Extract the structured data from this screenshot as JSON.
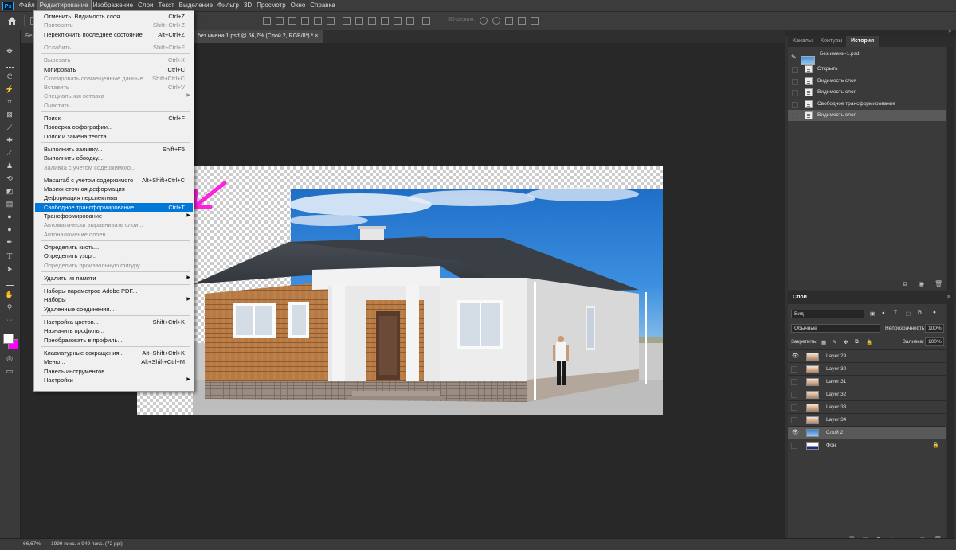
{
  "colors": {
    "accent": "#0078d7",
    "arrow": "#ff22dd",
    "fg_swatch": "#ffffff",
    "bg_swatch": "#ff00ff"
  },
  "menubar": {
    "items": [
      "Файл",
      "Редактирование",
      "Изображение",
      "Слои",
      "Текст",
      "Выделение",
      "Фильтр",
      "3D",
      "Просмотр",
      "Окно",
      "Справка"
    ],
    "active": "Редактирование"
  },
  "optbar": {
    "mode_3d": "3D-режим:"
  },
  "tabs": [
    {
      "label": "Без"
    },
    {
      "label": "без имени-1.psd @ 66,7% (Слой 2, RGB/8*) *",
      "close": "×"
    }
  ],
  "edit_menu": [
    {
      "label": "Отменить: Видимость слоя",
      "shortcut": "Ctrl+Z",
      "enabled": true
    },
    {
      "label": "Повторить",
      "shortcut": "Shift+Ctrl+Z",
      "enabled": false
    },
    {
      "label": "Переключить последнее состояние",
      "shortcut": "Alt+Ctrl+Z",
      "enabled": true
    },
    {
      "sep": true
    },
    {
      "label": "Ослабить...",
      "shortcut": "Shift+Ctrl+F",
      "enabled": false
    },
    {
      "sep": true
    },
    {
      "label": "Вырезать",
      "shortcut": "Ctrl+X",
      "enabled": false
    },
    {
      "label": "Копировать",
      "shortcut": "Ctrl+C",
      "enabled": true
    },
    {
      "label": "Скопировать совмещенные данные",
      "shortcut": "Shift+Ctrl+C",
      "enabled": false
    },
    {
      "label": "Вставить",
      "shortcut": "Ctrl+V",
      "enabled": false
    },
    {
      "label": "Специальная вставка",
      "shortcut": "",
      "enabled": false,
      "submenu": true
    },
    {
      "label": "Очистить",
      "shortcut": "",
      "enabled": false
    },
    {
      "sep": true
    },
    {
      "label": "Поиск",
      "shortcut": "Ctrl+F",
      "enabled": true
    },
    {
      "label": "Проверка орфографии...",
      "shortcut": "",
      "enabled": true
    },
    {
      "label": "Поиск и замена текста...",
      "shortcut": "",
      "enabled": true
    },
    {
      "sep": true
    },
    {
      "label": "Выполнить заливку...",
      "shortcut": "Shift+F5",
      "enabled": true
    },
    {
      "label": "Выполнить обводку...",
      "shortcut": "",
      "enabled": true
    },
    {
      "label": "Заливка с учетом содержимого...",
      "shortcut": "",
      "enabled": false
    },
    {
      "sep": true
    },
    {
      "label": "Масштаб с учетом содержимого",
      "shortcut": "Alt+Shift+Ctrl+C",
      "enabled": true
    },
    {
      "label": "Марионеточная деформация",
      "shortcut": "",
      "enabled": true
    },
    {
      "label": "Деформация перспективы",
      "shortcut": "",
      "enabled": true
    },
    {
      "label": "Свободное трансформирование",
      "shortcut": "Ctrl+T",
      "enabled": true,
      "highlighted": true
    },
    {
      "label": "Трансформирование",
      "shortcut": "",
      "enabled": true,
      "submenu": true
    },
    {
      "label": "Автоматически выравнивать слои...",
      "shortcut": "",
      "enabled": false
    },
    {
      "label": "Автоналожение слоев...",
      "shortcut": "",
      "enabled": false
    },
    {
      "sep": true
    },
    {
      "label": "Определить кисть...",
      "shortcut": "",
      "enabled": true
    },
    {
      "label": "Определить узор...",
      "shortcut": "",
      "enabled": true
    },
    {
      "label": "Определить произвольную фигуру...",
      "shortcut": "",
      "enabled": false
    },
    {
      "sep": true
    },
    {
      "label": "Удалить из памяти",
      "shortcut": "",
      "enabled": true,
      "submenu": true
    },
    {
      "sep": true
    },
    {
      "label": "Наборы параметров Adobe PDF...",
      "shortcut": "",
      "enabled": true
    },
    {
      "label": "Наборы",
      "shortcut": "",
      "enabled": true,
      "submenu": true
    },
    {
      "label": "Удаленные соединения...",
      "shortcut": "",
      "enabled": true
    },
    {
      "sep": true
    },
    {
      "label": "Настройка цветов...",
      "shortcut": "Shift+Ctrl+K",
      "enabled": true
    },
    {
      "label": "Назначить профиль...",
      "shortcut": "",
      "enabled": true
    },
    {
      "label": "Преобразовать в профиль...",
      "shortcut": "",
      "enabled": true
    },
    {
      "sep": true
    },
    {
      "label": "Клавиатурные сокращения...",
      "shortcut": "Alt+Shift+Ctrl+K",
      "enabled": true
    },
    {
      "label": "Меню...",
      "shortcut": "Alt+Shift+Ctrl+M",
      "enabled": true
    },
    {
      "label": "Панель инструментов...",
      "shortcut": "",
      "enabled": true
    },
    {
      "label": "Настройки",
      "shortcut": "",
      "enabled": true,
      "submenu": true
    }
  ],
  "submenu_arrow": "▶",
  "panels": {
    "collapse": "»",
    "tabs": [
      "Каналы",
      "Контуры",
      "История"
    ],
    "active_tab": "История",
    "history": {
      "snapshot": "Без имени-1.psd",
      "items": [
        "Открыть",
        "Видимость слоя",
        "Видимость слоя",
        "Свободное трансформирование",
        "Видимость слоя"
      ],
      "selected_index": 4
    },
    "layers": {
      "title": "Слои",
      "filter": "Вид",
      "blend": "Обычные",
      "opacity_label": "Непрозрачность:",
      "opacity": "100%",
      "lock_label": "Закрепить:",
      "fill_label": "Заливка:",
      "fill": "100%",
      "items": [
        {
          "name": "Layer 29",
          "visible": true
        },
        {
          "name": "Layer 30",
          "visible": false
        },
        {
          "name": "Layer 31",
          "visible": false
        },
        {
          "name": "Layer 32",
          "visible": false
        },
        {
          "name": "Layer 33",
          "visible": false
        },
        {
          "name": "Layer 34",
          "visible": false
        },
        {
          "name": "Слой 2",
          "visible": true,
          "selected": true
        },
        {
          "name": "Фон",
          "visible": false,
          "locked": true
        }
      ]
    }
  },
  "status": {
    "zoom": "66,67%",
    "doc": "1999 пикс. x 949 пикс. (72 ppi)"
  }
}
